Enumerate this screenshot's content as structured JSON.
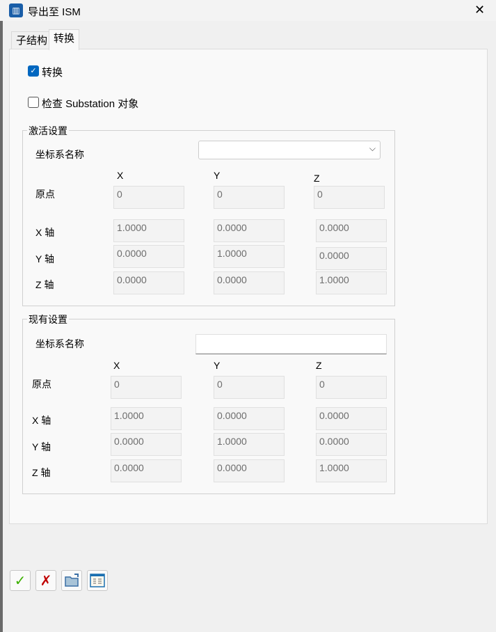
{
  "window": {
    "title": "导出至 ISM",
    "close": "✕"
  },
  "tabs": [
    "子结构",
    "转换"
  ],
  "convert": {
    "label": "转换",
    "checked": true
  },
  "check_substation": {
    "label": "检查 Substation 对象",
    "checked": false
  },
  "activation": {
    "title": "激活设置",
    "cs_label": "坐标系名称",
    "cs_value": "",
    "cols": [
      "X",
      "Y",
      "Z"
    ],
    "rows": [
      {
        "label": "原点",
        "values": [
          "0",
          "0",
          "0"
        ]
      },
      {
        "label": "X 轴",
        "values": [
          "1.0000",
          "0.0000",
          "0.0000"
        ]
      },
      {
        "label": "Y 轴",
        "values": [
          "0.0000",
          "1.0000",
          "0.0000"
        ]
      },
      {
        "label": "Z 轴",
        "values": [
          "0.0000",
          "0.0000",
          "1.0000"
        ]
      }
    ]
  },
  "existing": {
    "title": "现有设置",
    "cs_label": "坐标系名称",
    "cs_value": "",
    "cols": [
      "X",
      "Y",
      "Z"
    ],
    "rows": [
      {
        "label": "原点",
        "values": [
          "0",
          "0",
          "0"
        ]
      },
      {
        "label": "X 轴",
        "values": [
          "1.0000",
          "0.0000",
          "0.0000"
        ]
      },
      {
        "label": "Y 轴",
        "values": [
          "0.0000",
          "1.0000",
          "0.0000"
        ]
      },
      {
        "label": "Z 轴",
        "values": [
          "0.0000",
          "0.0000",
          "1.0000"
        ]
      }
    ]
  },
  "toolbar": [
    "ok-icon",
    "cancel-icon",
    "open-folder-icon",
    "table-icon"
  ]
}
